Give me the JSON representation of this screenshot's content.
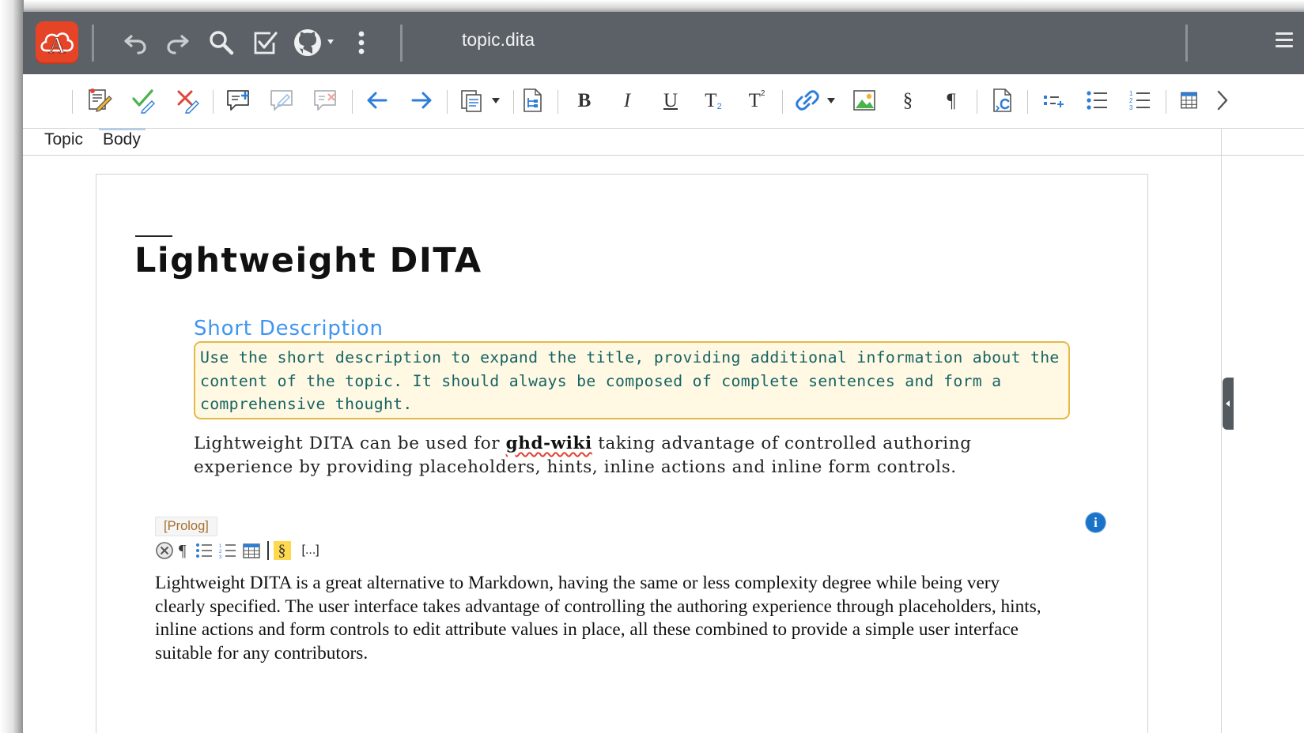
{
  "window": {
    "doc_title": "topic.dita"
  },
  "topbar": {
    "icons": [
      "app-logo-icon",
      "undo-icon",
      "redo-icon",
      "search-icon",
      "validate-icon",
      "github-icon",
      "more-vertical-icon",
      "hamburger-menu-icon"
    ]
  },
  "toolbar": {
    "bold_label": "B",
    "italic_label": "I",
    "underline_label": "U",
    "subscript_label": "T",
    "subscript_mark": "2",
    "superscript_label": "T",
    "superscript_mark": "2",
    "section_label": "§",
    "paragraph_label": "¶",
    "icons": [
      "edit-comment-icon",
      "accept-change-icon",
      "reject-change-icon",
      "add-comment-icon",
      "edit-comment-disabled-icon",
      "remove-comment-icon",
      "previous-change-icon",
      "next-change-icon",
      "paste-icon",
      "dropdown-arrow-icon",
      "insert-file-icon",
      "link-icon",
      "insert-image-icon",
      "insert-codeblock-icon",
      "insert-list-item-icon",
      "unordered-list-icon",
      "ordered-list-icon",
      "insert-table-icon",
      "chevron-right-icon"
    ]
  },
  "tabs": [
    {
      "label": "Topic"
    },
    {
      "label": "Body"
    }
  ],
  "document": {
    "title": "Lightweight DITA",
    "short_description_label": "Short Description",
    "short_description_lines": [
      "Use the short description to expand the title, providing additional information about the",
      "content of the topic. It should always be composed of complete sentences and form a",
      "comprehensive thought."
    ],
    "para1": {
      "before": "Lightweight DITA can be used for ",
      "link": "ghd-wiki",
      "after_line1": " taking advantage of controlled authoring",
      "line2": "experience by providing placeholders, hints, inline actions and inline form controls."
    },
    "prolog_label": "[Prolog]",
    "inline_actions": {
      "pilcrow": "¶",
      "section": "§",
      "more": "[...]"
    },
    "info_label": "i",
    "para2_lines": [
      "Lightweight DITA is a great alternative to Markdown, having the same or less complexity degree while being very",
      "clearly specified. The user interface takes advantage of controlling the authoring experience through placeholders, hints,",
      "inline actions and form controls to edit attribute values in place, all these combined to provide a simple user interface",
      "suitable for any contributors."
    ]
  },
  "colors": {
    "topbar": "#5b6166",
    "logo": "#e54427",
    "short_desc_label": "#3f95f0",
    "short_desc_text": "#156465",
    "short_desc_bg": "#fff8e3",
    "short_desc_border": "#e4b94a",
    "prolog_text": "#a4702d",
    "info_badge": "#1b73c7",
    "toolbar_accent_blue": "#2d7ed8",
    "toolbar_accent_green": "#4bb34b",
    "toolbar_accent_red": "#e0463a"
  }
}
